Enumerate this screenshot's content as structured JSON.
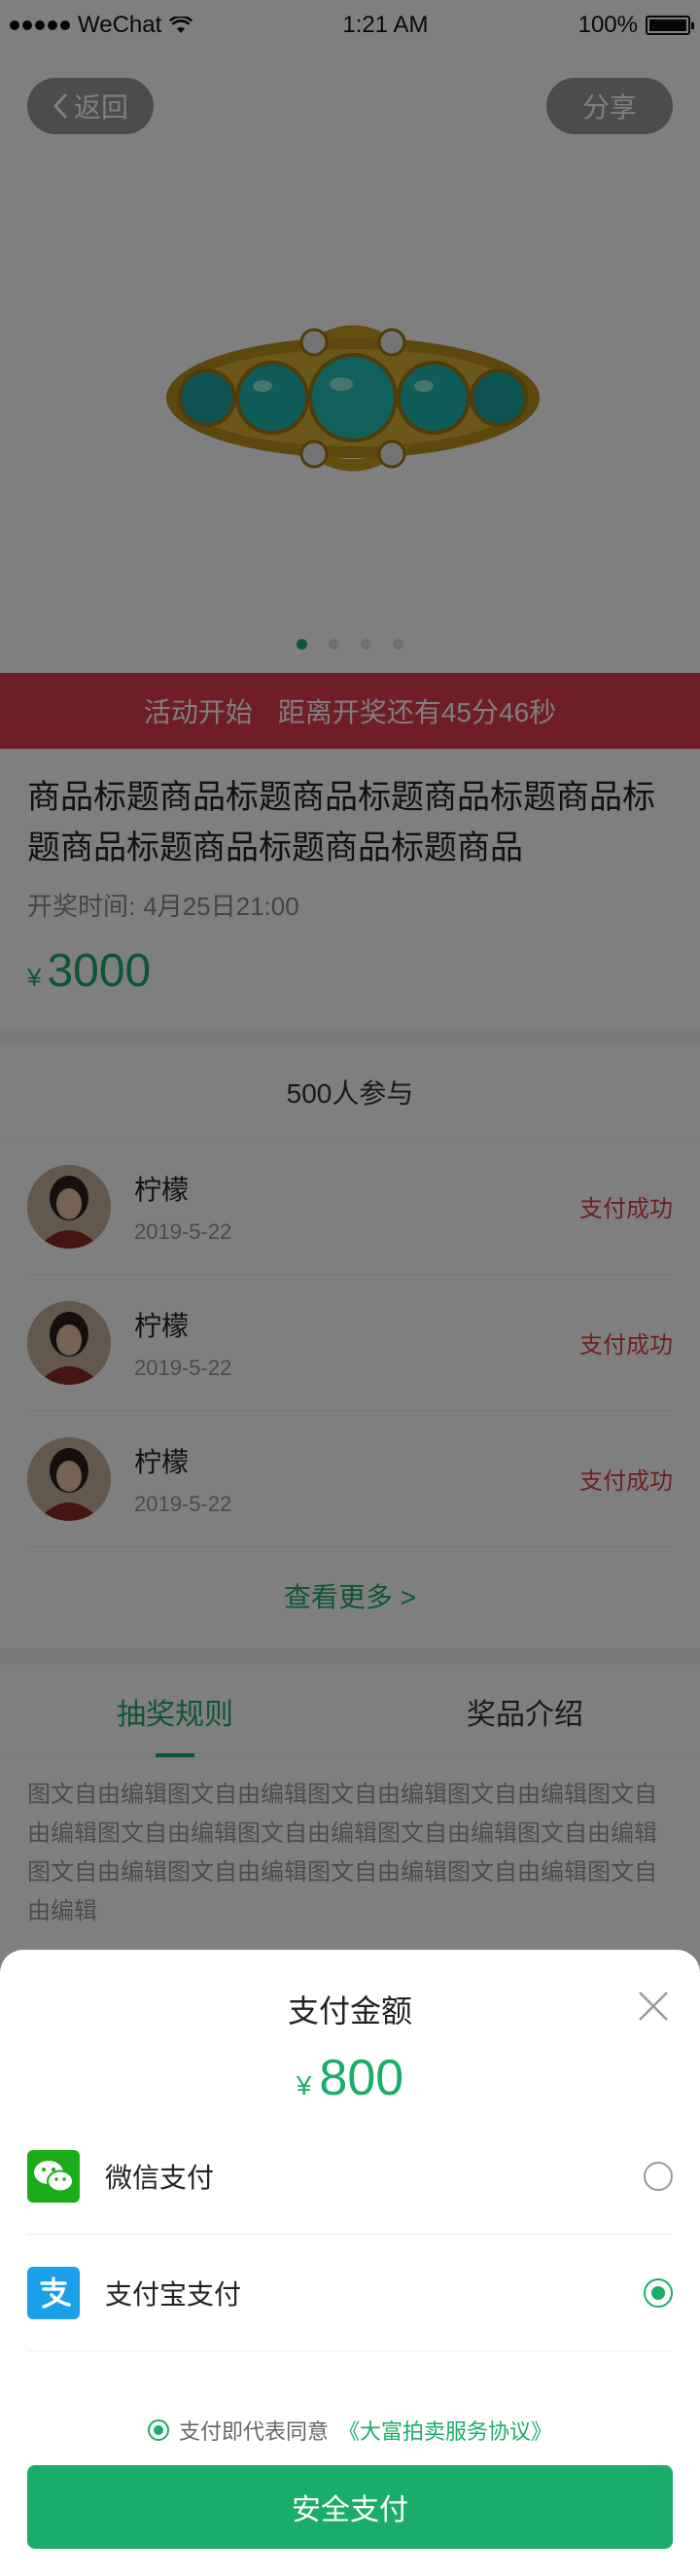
{
  "status_bar": {
    "carrier": "WeChat",
    "time": "1:21 AM",
    "battery": "100%"
  },
  "hero": {
    "back_label": "返回",
    "share_label": "分享",
    "pager_count": 4,
    "pager_active": 0
  },
  "countdown": {
    "status": "活动开始",
    "remaining": "距离开奖还有45分46秒"
  },
  "product": {
    "title": "商品标题商品标题商品标题商品标题商品标题商品标题商品标题商品标题商品",
    "draw_time_label": "开奖时间:",
    "draw_time": "4月25日21:00",
    "currency": "¥",
    "price": "3000"
  },
  "participants": {
    "header": "500人参与",
    "items": [
      {
        "name": "柠檬",
        "date": "2019-5-22",
        "status": "支付成功"
      },
      {
        "name": "柠檬",
        "date": "2019-5-22",
        "status": "支付成功"
      },
      {
        "name": "柠檬",
        "date": "2019-5-22",
        "status": "支付成功"
      }
    ],
    "more": "查看更多 >"
  },
  "tabs": {
    "items": [
      {
        "label": "抽奖规则"
      },
      {
        "label": "奖品介绍"
      }
    ],
    "active": 0,
    "rules_text": "图文自由编辑图文自由编辑图文自由编辑图文自由编辑图文自由编辑图文自由编辑图文自由编辑图文自由编辑图文自由编辑图文自由编辑图文自由编辑图文自由编辑图文自由编辑图文自由编辑"
  },
  "payment_sheet": {
    "title": "支付金额",
    "currency": "¥",
    "amount": "800",
    "methods": [
      {
        "label": "微信支付",
        "icon": "wechat-pay-icon",
        "selected": false
      },
      {
        "label": "支付宝支付",
        "icon": "alipay-icon",
        "selected": true
      }
    ],
    "agreement_prefix": "支付即代表同意",
    "agreement_link": "《大富拍卖服务协议》",
    "pay_button": "安全支付"
  },
  "colors": {
    "accent": "#1aad6a",
    "alert": "#e03c4b",
    "wechat": "#1aad19",
    "alipay": "#1a9fe8"
  }
}
